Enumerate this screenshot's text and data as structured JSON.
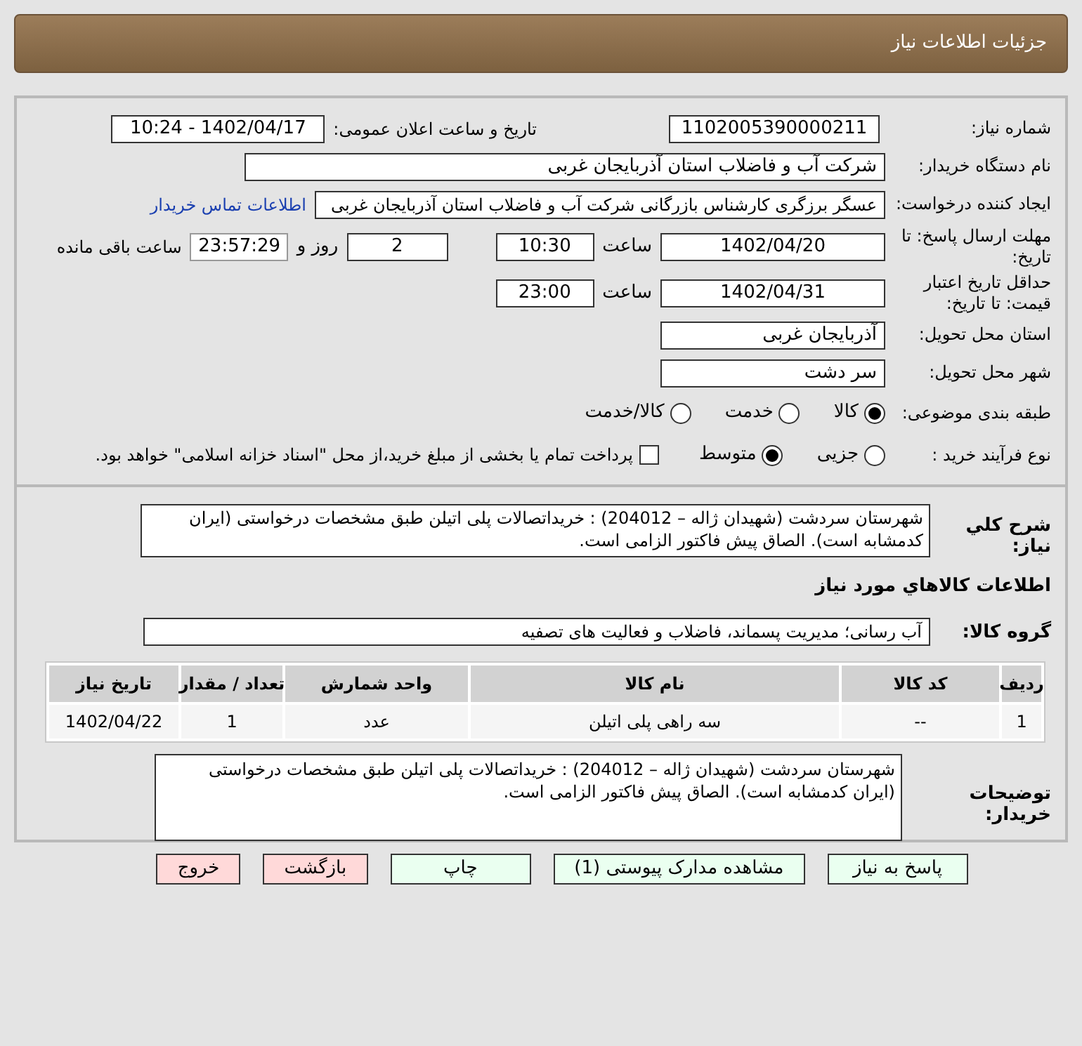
{
  "title": "جزئیات اطلاعات نیاز",
  "need_number": {
    "label": "شماره نیاز:",
    "value": "1102005390000211"
  },
  "announce": {
    "label": "تاریخ و ساعت اعلان عمومی:",
    "value": "1402/04/17 - 10:24"
  },
  "buyer_org": {
    "label": "نام دستگاه خریدار:",
    "value": "شرکت آب و فاضلاب استان آذربایجان غربی"
  },
  "requester": {
    "label": "ایجاد کننده درخواست:",
    "value": "عسگر  برزگری کارشناس بازرگانی شرکت آب و فاضلاب استان آذربایجان غربی",
    "link": "اطلاعات تماس خریدار"
  },
  "reply_deadline": {
    "label": "مهلت ارسال پاسخ: تا تاریخ:",
    "date": "1402/04/20",
    "time_label": "ساعت",
    "time": "10:30",
    "days": "2",
    "days_label": "روز و",
    "remaining": "23:57:29",
    "remaining_label": "ساعت باقی مانده"
  },
  "price_validity": {
    "label": "حداقل تاریخ اعتبار قیمت: تا تاریخ:",
    "date": "1402/04/31",
    "time_label": "ساعت",
    "time": "23:00"
  },
  "province": {
    "label": "استان محل تحویل:",
    "value": "آذربایجان غربی"
  },
  "city": {
    "label": "شهر محل تحویل:",
    "value": "سر دشت"
  },
  "category": {
    "label": "طبقه بندی موضوعی:",
    "options": [
      {
        "label": "کالا",
        "selected": true
      },
      {
        "label": "خدمت",
        "selected": false
      },
      {
        "label": "کالا/خدمت",
        "selected": false
      }
    ]
  },
  "purchase_type": {
    "label": "نوع فرآیند خرید :",
    "options": [
      {
        "label": "جزیی",
        "selected": false
      },
      {
        "label": "متوسط",
        "selected": true
      }
    ],
    "checkbox": {
      "label": "پرداخت تمام یا بخشی از مبلغ خرید،از محل \"اسناد خزانه اسلامی\" خواهد بود.",
      "checked": false
    }
  },
  "description": {
    "label": "شرح کلي نياز:",
    "value": "شهرستان سردشت  (شهیدان ژاله – 204012) : خریداتصالات پلی اتیلن طبق مشخصات درخواستی (ایران کدمشابه است). الصاق پیش فاکتور الزامی است."
  },
  "goods_heading": "اطلاعات کالاهاي مورد نياز",
  "goods_group": {
    "label": "گروه کالا:",
    "value": "آب رسانی؛ مدیریت پسماند، فاضلاب و فعالیت های تصفیه"
  },
  "table": {
    "columns": [
      "ردیف",
      "کد کالا",
      "نام کالا",
      "واحد شمارش",
      "تعداد / مقدار",
      "تاریخ نیاز"
    ],
    "rows": [
      [
        "1",
        "--",
        "سه راهی پلی اتیلن",
        "عدد",
        "1",
        "1402/04/22"
      ]
    ]
  },
  "buyer_notes": {
    "label": "توضیحات خریدار:",
    "value": "شهرستان سردشت  (شهیدان ژاله – 204012) : خریداتصالات پلی اتیلن طبق مشخصات درخواستی (ایران کدمشابه است). الصاق پیش فاکتور الزامی است."
  },
  "buttons": [
    {
      "label": "پاسخ به نیاز",
      "kind": "primary"
    },
    {
      "label": "مشاهده مدارک پیوستی (1)",
      "kind": "primary"
    },
    {
      "label": "چاپ",
      "kind": "primary"
    },
    {
      "label": "بازگشت",
      "kind": "danger"
    },
    {
      "label": "خروج",
      "kind": "danger"
    }
  ]
}
